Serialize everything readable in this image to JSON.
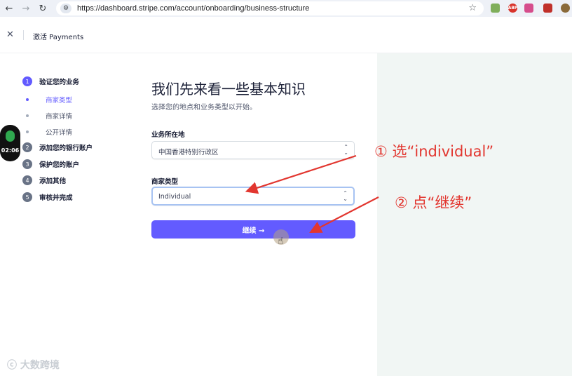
{
  "browser": {
    "url": "https://dashboard.stripe.com/account/onboarding/business-structure"
  },
  "header": {
    "title": "激活 Payments"
  },
  "sidebar": {
    "steps": [
      {
        "num": "1",
        "label": "验证您的业务"
      },
      {
        "num": "2",
        "label": "添加您的银行账户"
      },
      {
        "num": "3",
        "label": "保护您的账户"
      },
      {
        "num": "4",
        "label": "添加其他"
      },
      {
        "num": "5",
        "label": "审核并完成"
      }
    ],
    "substeps": [
      "商家类型",
      "商家详情",
      "公开详情"
    ]
  },
  "timer": "02:06",
  "main": {
    "heading": "我们先来看一些基本知识",
    "subheading": "选择您的地点和业务类型以开始。",
    "location_label": "业务所在地",
    "location_value": "中国香港特别行政区",
    "type_label": "商家类型",
    "type_value": "Individual",
    "continue_label": "继续 →"
  },
  "annotations": {
    "step1": "① 选“individual”",
    "step2": "② 点“继续”"
  },
  "watermark": "大数跨境",
  "colors": {
    "accent": "#635bff",
    "annotation": "#e2362f",
    "right_panel": "#f1f6f4"
  }
}
